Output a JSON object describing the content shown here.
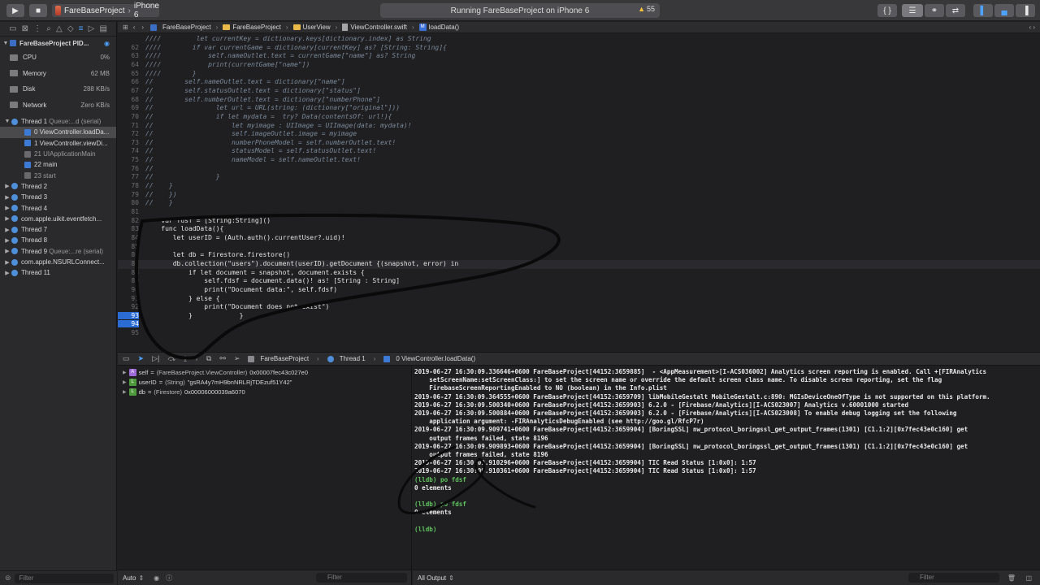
{
  "toolbar": {
    "scheme_project": "FareBaseProject",
    "scheme_device": "iPhone 6",
    "activity": "Running FareBaseProject on iPhone 6",
    "warnings": "55"
  },
  "navigator": {
    "process": "FareBaseProject PID...",
    "gauges": [
      {
        "label": "CPU",
        "value": "0%"
      },
      {
        "label": "Memory",
        "value": "62 MB"
      },
      {
        "label": "Disk",
        "value": "288 KB/s"
      },
      {
        "label": "Network",
        "value": "Zero KB/s"
      }
    ],
    "thread1": {
      "name": "Thread 1",
      "queue": "Queue:...d (serial)"
    },
    "frames": [
      "0 ViewController.loadDa...",
      "1 ViewController.viewDi...",
      "21 UIApplicationMain",
      "22 main",
      "23 start"
    ],
    "threads": [
      "Thread 2",
      "Thread 3",
      "Thread 4",
      "com.apple.uikit.eventfetch...",
      "Thread 7",
      "Thread 8",
      "Thread 9",
      "com.apple.NSURLConnect...",
      "Thread 11"
    ],
    "thread9_queue": "Queue:...re (serial)",
    "filter_placeholder": "Filter"
  },
  "jumpbar": {
    "crumbs": [
      "FareBaseProject",
      "FareBaseProject",
      "UserView",
      "ViewController.swift",
      "loadData()"
    ]
  },
  "editor": {
    "lines": [
      {
        "n": "",
        "t": "////         let currentKey = dictionary.keys[dictionary.index] as String",
        "c": true
      },
      {
        "n": "62",
        "t": "////        if var currentGame = dictionary[currentKey] as? [String: String]{",
        "c": true
      },
      {
        "n": "63",
        "t": "////            self.nameOutlet.text = currentGame[\"name\"] as? String",
        "c": true
      },
      {
        "n": "64",
        "t": "////            print(currentGame[\"name\"])",
        "c": true
      },
      {
        "n": "65",
        "t": "////        }",
        "c": true
      },
      {
        "n": "66",
        "t": "//        self.nameOutlet.text = dictionary[\"name\"]",
        "c": true
      },
      {
        "n": "67",
        "t": "//        self.statusOutlet.text = dictionary[\"status\"]",
        "c": true
      },
      {
        "n": "68",
        "t": "//        self.numberOutlet.text = dictionary[\"numberPhone\"]",
        "c": true
      },
      {
        "n": "69",
        "t": "//                let url = URL(string: (dictionary[\"original\"]))",
        "c": true
      },
      {
        "n": "70",
        "t": "//                if let mydata =  try? Data(contentsOf: url!){",
        "c": true
      },
      {
        "n": "71",
        "t": "//                    let myimage : UIImage = UIImage(data: mydata)!",
        "c": true
      },
      {
        "n": "72",
        "t": "//                    self.imageOutlet.image = myimage",
        "c": true
      },
      {
        "n": "73",
        "t": "//                    numberPhoneModel = self.numberOutlet.text!",
        "c": true
      },
      {
        "n": "74",
        "t": "//                    statusModel = self.statusOutlet.text!",
        "c": true
      },
      {
        "n": "75",
        "t": "//                    nameModel = self.nameOutlet.text!",
        "c": true
      },
      {
        "n": "76",
        "t": "//",
        "c": true
      },
      {
        "n": "77",
        "t": "//                }",
        "c": true
      },
      {
        "n": "78",
        "t": "//    }",
        "c": true
      },
      {
        "n": "79",
        "t": "//    })",
        "c": true
      },
      {
        "n": "80",
        "t": "//    }",
        "c": true
      },
      {
        "n": "81",
        "t": "",
        "c": false
      },
      {
        "n": "82",
        "t": "    var fdsf = [String:String]()",
        "c": false
      },
      {
        "n": "83",
        "t": "    func loadData(){",
        "c": false
      },
      {
        "n": "84",
        "t": "       let userID = (Auth.auth().currentUser?.uid)!",
        "c": false
      },
      {
        "n": "85",
        "t": "",
        "c": false
      },
      {
        "n": "86",
        "t": "       let db = Firestore.firestore()",
        "c": false
      },
      {
        "n": "87",
        "t": "       db.collection(\"users\").document(userID).getDocument {(snapshot, error) in",
        "c": false
      },
      {
        "n": "88",
        "t": "           if let document = snapshot, document.exists {",
        "c": false
      },
      {
        "n": "89",
        "t": "               self.fdsf = document.data()! as! [String : String]",
        "c": false
      },
      {
        "n": "90",
        "t": "               print(\"Document data:\", self.fdsf)",
        "c": false
      },
      {
        "n": "91",
        "t": "           } else {",
        "c": false
      },
      {
        "n": "92",
        "t": "               print(\"Document does not exist\")",
        "c": false
      },
      {
        "n": "93",
        "t": "           }            }",
        "c": false
      },
      {
        "n": "94",
        "t": "",
        "c": false
      },
      {
        "n": "95",
        "t": "",
        "c": false
      }
    ]
  },
  "debugbar": {
    "crumbs": [
      "FareBaseProject",
      "Thread 1",
      "0 ViewController.loadData()"
    ]
  },
  "variables": [
    {
      "badge": "A",
      "name": "self",
      "type": "(FareBaseProject.ViewController)",
      "value": "0x00007fec43c027e0"
    },
    {
      "badge": "L",
      "name": "userID",
      "type": "(String)",
      "value": "\"gsRA4y7mH9bnNRLRjTDEzuf51Y42\""
    },
    {
      "badge": "L",
      "name": "db",
      "type": "(Firestore)",
      "value": "0x00006000039a6070"
    }
  ],
  "variables_footer": {
    "mode": "Auto",
    "filter_placeholder": "Filter"
  },
  "console": {
    "lines": [
      {
        "t": "2019-06-27 16:30:09.336646+0600 FareBaseProject[44152:3659885]  - <AppMeasurement>[I-ACS036002] Analytics screen reporting is enabled. Call +[FIRAnalytics",
        "l": false
      },
      {
        "t": "    setScreenName:setScreenClass:] to set the screen name or override the default screen class name. To disable screen reporting, set the flag",
        "l": false
      },
      {
        "t": "    FirebaseScreenReportingEnabled to NO (boolean) in the Info.plist",
        "l": false
      },
      {
        "t": "2019-06-27 16:30:09.364555+0600 FareBaseProject[44152:3659709] libMobileGestalt MobileGestalt.c:890: MGIsDeviceOneOfType is not supported on this platform.",
        "l": false
      },
      {
        "t": "2019-06-27 16:30:09.500340+0600 FareBaseProject[44152:3659903] 6.2.0 - [Firebase/Analytics][I-ACS023007] Analytics v.60001000 started",
        "l": false
      },
      {
        "t": "2019-06-27 16:30:09.500884+0600 FareBaseProject[44152:3659903] 6.2.0 - [Firebase/Analytics][I-ACS023008] To enable debug logging set the following",
        "l": false
      },
      {
        "t": "    application argument: -FIRAnalyticsDebugEnabled (see http://goo.gl/RfcP7r)",
        "l": false
      },
      {
        "t": "2019-06-27 16:30:09.909741+0600 FareBaseProject[44152:3659904] [BoringSSL] nw_protocol_boringssl_get_output_frames(1301) [C1.1:2][0x7fec43e0c160] get",
        "l": false
      },
      {
        "t": "    output frames failed, state 8196",
        "l": false
      },
      {
        "t": "2019-06-27 16:30:09.909893+0600 FareBaseProject[44152:3659904] [BoringSSL] nw_protocol_boringssl_get_output_frames(1301) [C1.1:2][0x7fec43e0c160] get",
        "l": false
      },
      {
        "t": "    output frames failed, state 8196",
        "l": false
      },
      {
        "t": "2019-06-27 16:30:09.910296+0600 FareBaseProject[44152:3659904] TIC Read Status [1:0x0]: 1:57",
        "l": false
      },
      {
        "t": "2019-06-27 16:30:09.910361+0600 FareBaseProject[44152:3659904] TIC Read Status [1:0x0]: 1:57",
        "l": false
      },
      {
        "t": "(lldb) po fdsf",
        "l": true
      },
      {
        "t": "0 elements",
        "l": false
      },
      {
        "t": "",
        "l": false
      },
      {
        "t": "(lldb) po fdsf",
        "l": true
      },
      {
        "t": "0 elements",
        "l": false
      },
      {
        "t": "",
        "l": false
      },
      {
        "t": "(lldb)",
        "l": true
      }
    ]
  },
  "console_footer": {
    "mode": "All Output",
    "filter_placeholder": "Filter"
  }
}
